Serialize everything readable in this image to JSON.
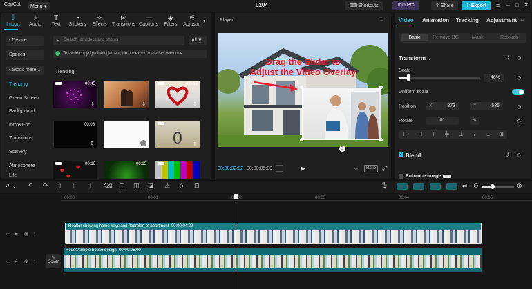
{
  "app": {
    "logo": "CapCut",
    "menu_label": "Menu",
    "project_title": "0204"
  },
  "topbar": {
    "shortcuts_label": "Shortcuts",
    "join_pro_label": "Join Pro",
    "share_label": "Share",
    "export_label": "Export"
  },
  "media_tabs": [
    {
      "label": "Import",
      "icon": "import-icon",
      "active": true
    },
    {
      "label": "Audio",
      "icon": "audio-icon"
    },
    {
      "label": "Text",
      "icon": "text-icon"
    },
    {
      "label": "Stickers",
      "icon": "sticker-icon"
    },
    {
      "label": "Effects",
      "icon": "effects-icon"
    },
    {
      "label": "Transitions",
      "icon": "transitions-icon"
    },
    {
      "label": "Captions",
      "icon": "captions-icon"
    },
    {
      "label": "Filters",
      "icon": "filters-icon"
    },
    {
      "label": "Adjustm",
      "icon": "adjustment-icon"
    }
  ],
  "sidebar": {
    "device": "• Device",
    "spaces": "Spaces",
    "stock": "• Stock mate...",
    "items": [
      "Trending",
      "Green Screen",
      "Background",
      "Intro&End",
      "Transitions",
      "Scenery",
      "Atmosphere",
      "Life"
    ]
  },
  "search": {
    "placeholder": "Search for videos and photos",
    "filter_label": "All"
  },
  "copyright_notice": "To avoid copyright infringement, do not export materials without e",
  "media_section_title": "Trending",
  "thumbs": [
    {
      "duration": "00:45"
    },
    {
      "duration": ""
    },
    {
      "duration": "00:17"
    },
    {
      "duration": "00:06"
    },
    {
      "duration": ""
    },
    {
      "duration": ""
    },
    {
      "duration": "00:10"
    },
    {
      "duration": "00:15"
    },
    {
      "duration": ""
    }
  ],
  "player": {
    "title": "Player",
    "annotation_line1": "Drag the Slider to",
    "annotation_line2": "Adjust the Video Overlay",
    "current_time": "00:00:02:02",
    "total_time": "00:00:05:00",
    "ratio_label": "Ratio"
  },
  "right_panel": {
    "tabs": [
      "Video",
      "Animation",
      "Tracking",
      "Adjustment"
    ],
    "subtabs": [
      "Basic",
      "Remove BG",
      "Mask",
      "Retouch"
    ],
    "transform_label": "Transform",
    "scale_label": "Scale",
    "scale_value": "46%",
    "scale_fraction": 0.46,
    "uniform_scale_label": "Uniform scale",
    "position_label": "Position",
    "pos_x_label": "X",
    "pos_x_value": "873",
    "pos_y_label": "Y",
    "pos_y_value": "-535",
    "rotate_label": "Rotate",
    "rotate_value": "0°",
    "blend_label": "Blend",
    "enhance_label": "Enhance image"
  },
  "timeline": {
    "ruler": [
      "00:00",
      "00:01",
      "00:02",
      "00:03",
      "00:04",
      "00:05"
    ],
    "overlay_clip": {
      "title": "Realtor showing home keys and floorplan of apartment",
      "duration": "00:00:04:29"
    },
    "main_clip": {
      "title": "House/simple house design",
      "duration": "00:00:05:00"
    },
    "cover_label": "Cover"
  },
  "colors": {
    "accent": "#39c4e0",
    "annotation": "#e0202a",
    "overlay_track": "#1a7f84",
    "main_track": "#106a74"
  }
}
